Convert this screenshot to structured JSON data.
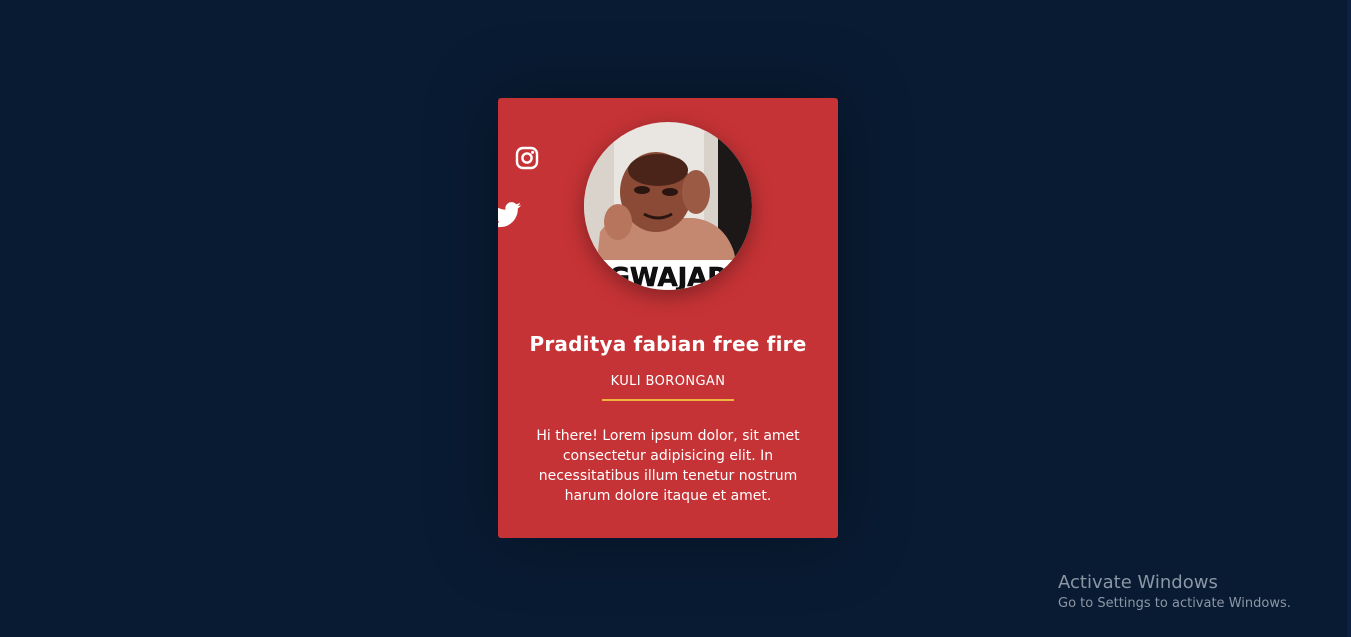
{
  "profile": {
    "name": "Praditya fabian free fire",
    "job_title": "KULI BORONGAN",
    "bio": "Hi there! Lorem ipsum dolor, sit amet consectetur adipisicing elit. In necessitatibus illum tenetur nostrum harum dolore itaque et amet.",
    "avatar_caption": "GWAJAR"
  },
  "social": [
    {
      "icon": "instagram-icon"
    },
    {
      "icon": "twitter-icon"
    }
  ],
  "colors": {
    "background": "#091b33",
    "card": "#c63336",
    "accent_underline": "#f0b43c",
    "text": "#ffffff"
  },
  "watermark": {
    "title": "Activate Windows",
    "subtitle": "Go to Settings to activate Windows."
  }
}
